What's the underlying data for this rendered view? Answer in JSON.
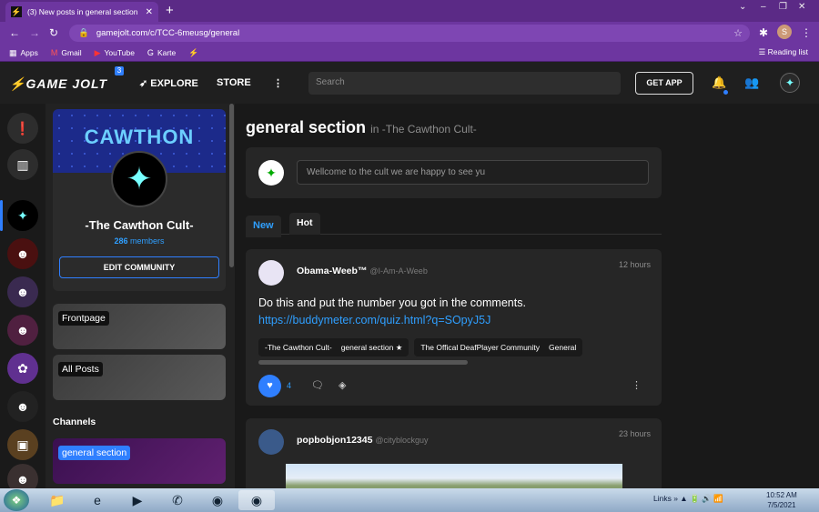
{
  "browser": {
    "tab_title": "(3) New posts in general section",
    "tab_favicon": "⚡",
    "tab_close": "✕",
    "new_tab": "+",
    "url": "gamejolt.com/c/TCC-6meusg/general",
    "bookmarks": [
      {
        "icon": "▦",
        "label": "Apps"
      },
      {
        "icon": "M",
        "label": "Gmail"
      },
      {
        "icon": "▶",
        "label": "YouTube"
      },
      {
        "icon": "G",
        "label": "Karte"
      },
      {
        "icon": "⚡",
        "label": ""
      }
    ],
    "reading_list": "Reading list",
    "profile_initial": "S"
  },
  "gj": {
    "logo": "GAME JOLT",
    "badge": "3",
    "explore": "EXPLORE",
    "store": "STORE",
    "search_placeholder": "Search",
    "get_app": "GET APP"
  },
  "community": {
    "banner_text": "CAWTHON",
    "name": "-The Cawthon Cult-",
    "member_count": "286",
    "members_label": "members",
    "edit_button": "EDIT COMMUNITY",
    "channels_heading": "Channels",
    "channels": [
      "Frontpage",
      "All Posts",
      "general section"
    ]
  },
  "main": {
    "title": "general section",
    "title_in": "in -The Cawthon Cult-",
    "composer_placeholder": "Wellcome to the cult we are happy to see yu",
    "tabs": [
      "New",
      "Hot"
    ]
  },
  "posts": [
    {
      "user": "Obama-Weeb™",
      "handle": "@I-Am-A-Weeb",
      "time": "12 hours",
      "text": "Do this and put the number you got in the comments.",
      "link": "https://buddymeter.com/quiz.html?q=SOpyJ5J",
      "pills": [
        {
          "community": "-The Cawthon Cult-",
          "channel": "general section ★"
        },
        {
          "community": "The Offical DeafPlayer Community",
          "channel": "General"
        }
      ],
      "likes": "4"
    },
    {
      "user": "popbobjon12345",
      "handle": "@cityblockguy",
      "time": "23 hours"
    }
  ],
  "taskbar": {
    "links": "Links",
    "time": "10:52 AM",
    "date": "7/5/2021"
  }
}
